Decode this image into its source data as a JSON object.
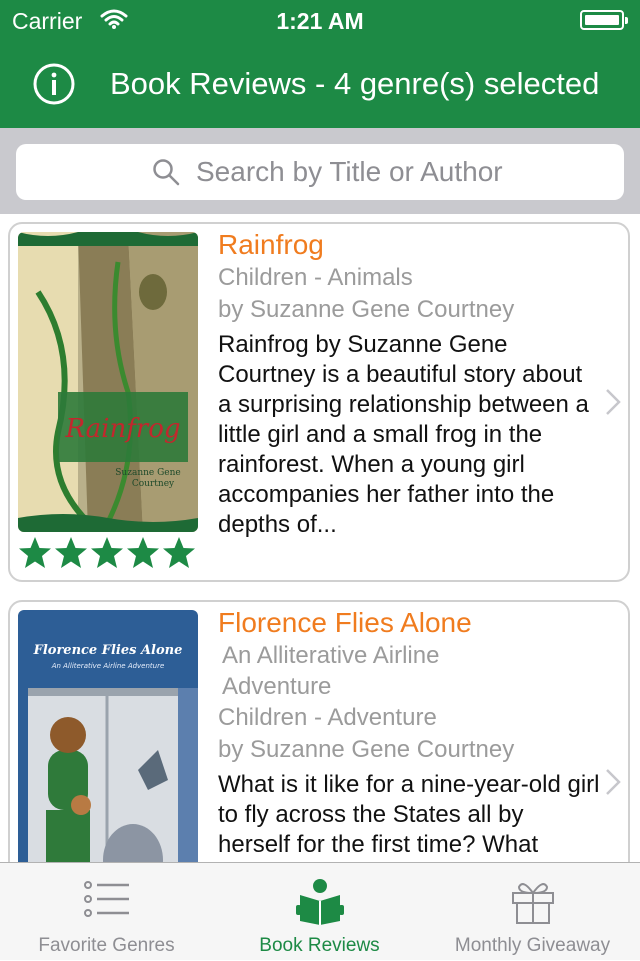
{
  "status_bar": {
    "carrier": "Carrier",
    "time": "1:21 AM"
  },
  "nav": {
    "title": "Book Reviews - 4 genre(s) selected",
    "info_icon": "info-icon"
  },
  "search": {
    "placeholder": "Search by Title or Author",
    "value": ""
  },
  "books": [
    {
      "title": "Rainfrog",
      "genre": "Children - Animals",
      "author": "by Suzanne Gene Courtney",
      "description": "Rainfrog by Suzanne Gene Courtney is a beautiful story about a surprising relationship between a little girl and a small frog in the rainforest. When a young girl accompanies her father into the depths of...",
      "rating": 5,
      "cover_title": "Rainfrog",
      "cover_author_line1": "Suzanne Gene",
      "cover_author_line2": "Courtney"
    },
    {
      "title": "Florence Flies Alone",
      "subtitle": "An Alliterative Airline Adventure",
      "genre": "Children - Adventure",
      "author": "by Suzanne Gene Courtney",
      "description": "What is it like for a nine-year-old girl to fly across the States all by herself for the first time? What",
      "cover_title": "Florence Flies Alone",
      "cover_subtitle": "An Alliterative Airline Adventure"
    }
  ],
  "tabs": [
    {
      "label": "Favorite Genres",
      "icon": "list-icon",
      "active": false
    },
    {
      "label": "Book Reviews",
      "icon": "book-reader-icon",
      "active": true
    },
    {
      "label": "Monthly Giveaway",
      "icon": "gift-icon",
      "active": false
    }
  ],
  "colors": {
    "brand_green": "#1d8a45",
    "title_orange": "#f07c1f",
    "muted_gray": "#9b9b9b",
    "star_green": "#1d8a45"
  }
}
